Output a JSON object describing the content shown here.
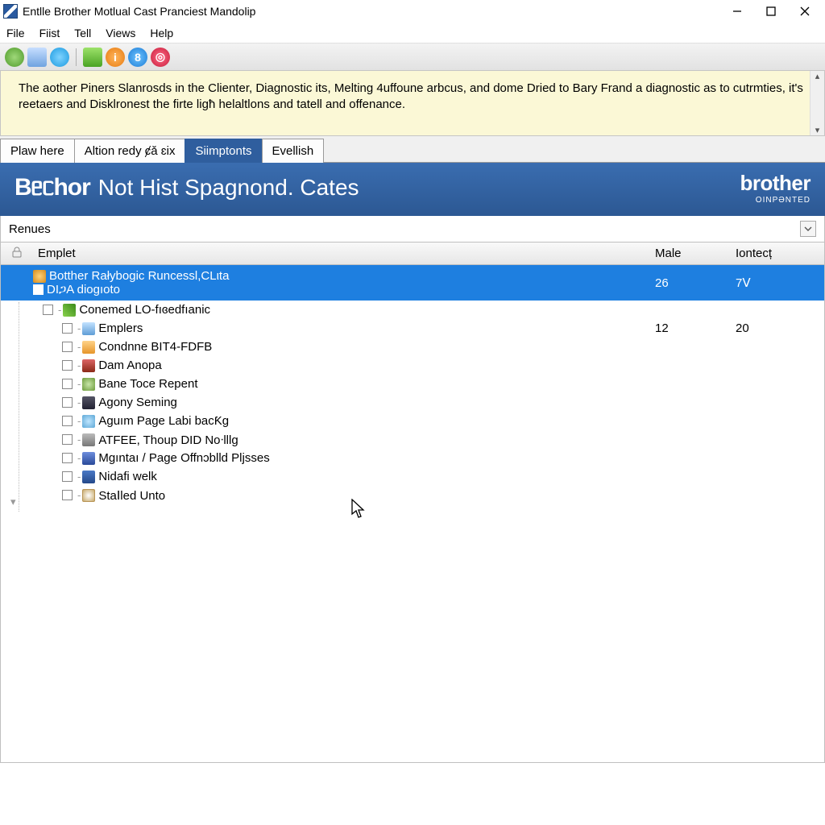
{
  "window": {
    "title": "Entlle Brother Motlual Cast Pranciest Mandolip"
  },
  "menu": {
    "file": "File",
    "fiist": "Fiist",
    "tell": "Tell",
    "views": "Views",
    "help": "Help"
  },
  "toolbar_icons": {
    "i1": "globe-icon",
    "i2": "save-icon",
    "i3": "refresh-icon",
    "i4": "chart-icon",
    "i5": "info-icon",
    "i6": "user-icon",
    "i7": "target-icon"
  },
  "notice": {
    "text": "The aother Piners Slanrosds in the Clienter, Diagnostic its, Melting 4uffoune arbcus, and dome Dried to Bary Frand a diagnostic as to cutrmties, it's reetaers and Disklronest the firte ligħ helaltlons and tatell and offenance."
  },
  "tabs": {
    "t1": "Plaw here",
    "t2": "Altion redy ȼǎ ɛix",
    "t3": "Siimptonts",
    "t4": "Evellish"
  },
  "banner": {
    "logo": "Bᥱᥴhor",
    "title": "Not Hist Spagnond. Cates",
    "brand": "brother",
    "brand_sub": "OINPƏNTED"
  },
  "dropdown": {
    "label": "Renues"
  },
  "columns": {
    "lock": "🔒",
    "emplet": "Emplet",
    "male": "Male",
    "iontect": "Iontecț"
  },
  "rows": {
    "r0": {
      "label": "Botther Rałybogic Runcessl,CLιta",
      "sub": "DIጋA diogıoto",
      "male": "26",
      "iontect": "7ꓦ"
    },
    "r1": {
      "label": "Conemed LO-fıɞedfıanic",
      "male": "",
      "iontect": ""
    },
    "r2": {
      "label": "Emplers",
      "male": "12",
      "iontect": "20"
    },
    "r3": {
      "label": "Condnne BIT4-FDFB"
    },
    "r4": {
      "label": "Dam Anopa"
    },
    "r5": {
      "label": "Bane Toce Repent"
    },
    "r6": {
      "label": "Agony Seming"
    },
    "r7": {
      "label": "Aguım Page Labi bacƘg"
    },
    "r8": {
      "label": "ATFEE, Thoup DID Noᐧlllg"
    },
    "r9": {
      "label": "Mgıntaı / Page Offnɔblld Pǉsses"
    },
    "r10": {
      "label": "Nidafi welk"
    },
    "r11": {
      "label": "Staꓲled Unto"
    }
  }
}
